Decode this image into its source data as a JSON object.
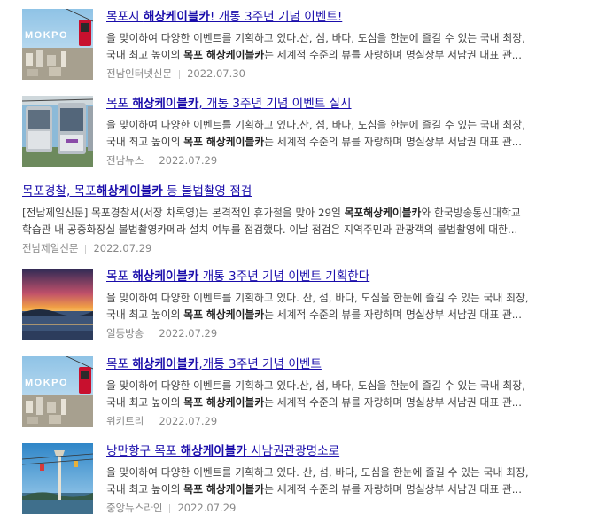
{
  "items": [
    {
      "title_pre": "목포시 ",
      "title_bold": "해상케이블카",
      "title_post": "! 개통 3주년 기념 이벤트!",
      "line1": "을 맞이하여 다양한 이벤트를 기획하고 있다.산, 섬, 바다, 도심을 한눈에 즐길 수 있는 국내 최장,",
      "line2_pre": "국내 최고 높이의 ",
      "line2_bold": "목포 해상케이블카",
      "line2_post": "는 세계적 수준의 뷰를 자랑하며 명실상부 서남권 대표 관...",
      "source": "전남인터넷신문",
      "date": "2022.07.30",
      "thumb": "mokpo-cablecar-city-photo",
      "thumb_text": "MOKPO"
    },
    {
      "title_pre": "목포 ",
      "title_bold": "해상케이블카",
      "title_post": ", 개통 3주년 기념 이벤트 실시",
      "line1": "을 맞이하여 다양한 이벤트를 기획하고 있다.산, 섬, 바다, 도심을 한눈에 즐길 수 있는 국내 최장,",
      "line2_pre": "국내 최고 높이의 ",
      "line2_bold": "목포 해상케이블카",
      "line2_post": "는 세계적 수준의 뷰를 자랑하며 명실상부 서남권 대표 관...",
      "source": "전남뉴스",
      "date": "2022.07.29",
      "thumb": "cablecar-cabins-photo"
    },
    {
      "title_pre": "목포경찰, 목포",
      "title_bold": "해상케이블카",
      "title_post": " 등 불법촬영 점검",
      "line1_pre": "[전남제일신문] 목포경찰서(서장 차록영)는 본격적인 휴가철을 맞아 29일 ",
      "line1_bold": "목포해상케이블카",
      "line1_post": "와 한국방송통신대학교",
      "line2": "학습관 내 공중화장실 불법촬영카메라 설치 여부를 점검했다. 이날 점검은 지역주민과 관광객의 불법촬영에 대한...",
      "source": "전남제일신문",
      "date": "2022.07.29"
    },
    {
      "title_pre": "목포 ",
      "title_bold": "해상케이블카",
      "title_post": " 개통 3주년 기념 이벤트 기획한다",
      "line1": "을 맞이하여 다양한 이벤트를 기획하고 있다. 산, 섬, 바다, 도심을 한눈에 즐길 수 있는 국내 최장,",
      "line2_pre": "국내 최고 높이의 ",
      "line2_bold": "목포 해상케이블카",
      "line2_post": "는 세계적 수준의 뷰를 자랑하며 명실상부 서남권 대표 관...",
      "source": "일등방송",
      "date": "2022.07.29",
      "thumb": "sunset-sea-photo"
    },
    {
      "title_pre": "목포 ",
      "title_bold": "해상케이블카",
      "title_post": ",개통 3주년 기념 이벤트",
      "line1": "을 맞이하여 다양한 이벤트를 기획하고 있다.산, 섬, 바다, 도심을 한눈에 즐길 수 있는 국내 최장,",
      "line2_pre": "국내 최고 높이의 ",
      "line2_bold": "목포 해상케이블카",
      "line2_post": "는 세계적 수준의 뷰를 자랑하며 명실상부 서남권 대표 관...",
      "source": "위키트리",
      "date": "2022.07.29",
      "thumb": "mokpo-cablecar-city-photo",
      "thumb_text": "MOKPO"
    },
    {
      "title_pre": "낭만항구 목포 ",
      "title_bold": "해상케이블카",
      "title_post": " 서남권관광명소로",
      "line1": "을 맞이하여 다양한 이벤트를 기획하고 있다. 산, 섬, 바다, 도심을 한눈에 즐길 수 있는 국내 최장,",
      "line2_pre": "국내 최고 높이의 ",
      "line2_bold": "목포 해상케이블카",
      "line2_post": "는 세계적 수준의 뷰를 자랑하며 명실상부 서남권 대표 관...",
      "source": "중앙뉴스라인",
      "date": "2022.07.29",
      "thumb": "cablecar-tower-blue-sky-photo"
    }
  ]
}
